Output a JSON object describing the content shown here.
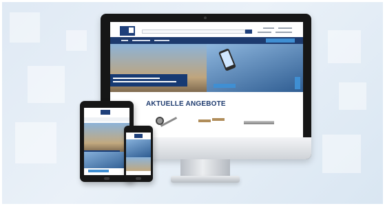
{
  "hero": {
    "monitor_section_title": "AKTUELLE ANGEBOTE"
  },
  "colors": {
    "brand_navy": "#1d3a6e",
    "accent_blue": "#3f8fd3",
    "background": "#e3ecf6"
  },
  "devices": [
    "monitor",
    "tablet",
    "smartphone"
  ]
}
